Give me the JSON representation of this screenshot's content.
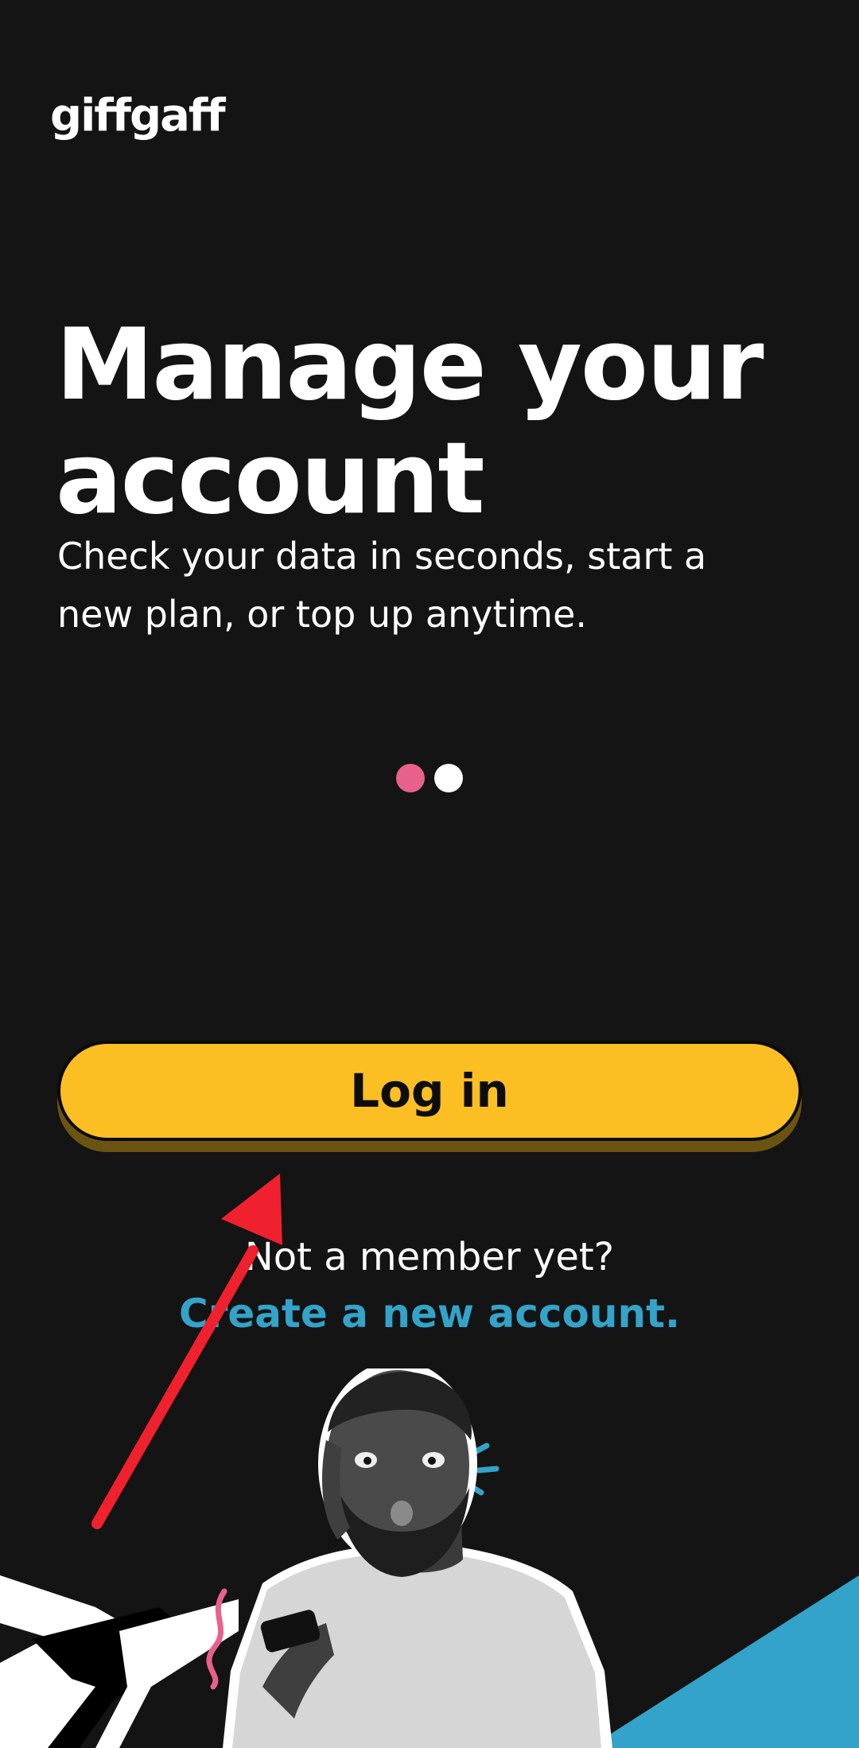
{
  "brand": {
    "logo_text": "giffgaff"
  },
  "hero": {
    "headline_line1": "Manage your",
    "headline_line2": "account",
    "subtitle_line1": "Check your data in seconds, start a",
    "subtitle_line2": "new plan, or top up anytime."
  },
  "carousel": {
    "active_index": 0,
    "count": 2,
    "active_color": "#e8618c",
    "inactive_color": "#ffffff"
  },
  "actions": {
    "login_label": "Log in",
    "login_color": "#fbbf24",
    "login_shadow_color": "#6b5412",
    "not_member_text": "Not a member yet?",
    "create_account_label": "Create a new account.",
    "link_color": "#33a3c9"
  },
  "illustration": {
    "description_icon": "surprised-man-with-phone-illustration",
    "accent_blue": "#33a3c9",
    "accent_pink": "#e8618c"
  },
  "annotation": {
    "arrow_color": "#f0212e",
    "icon": "red-arrow-icon"
  }
}
